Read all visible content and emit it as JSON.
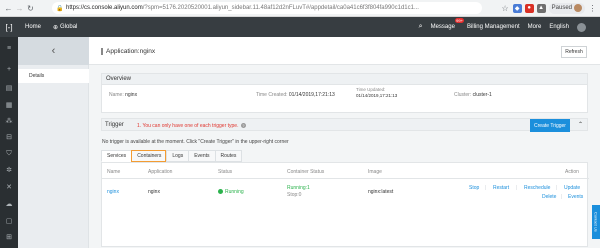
{
  "browser": {
    "url_host": "https://cs.console.aliyun.com",
    "url_path": "/?spm=5176.2020520001.aliyun_sidebar.11.48af12d2nFLuvT#/appdetail/ca0a41c6f3f804fa990c1d1c1...",
    "profile_status": "Paused"
  },
  "topbar": {
    "home": "Home",
    "region": "Global",
    "message": "Message",
    "message_badge": "99+",
    "billing": "Billing Management",
    "more": "More",
    "language": "English"
  },
  "sidebar": {
    "back_label": "‹",
    "items": [
      {
        "label": "Details"
      }
    ]
  },
  "page": {
    "title": "Application:nginx",
    "refresh_label": "Refresh"
  },
  "overview": {
    "heading": "Overview",
    "name_label": "Name:",
    "name_value": "nginx",
    "created_label": "Time Created:",
    "created_value": "01/14/2019,17:21:13",
    "updated_label": "Time Updated:",
    "updated_value": "01/14/2019,17:21:13",
    "cluster_label": "Cluster:",
    "cluster_value": "cluster-1"
  },
  "trigger": {
    "label": "Trigger",
    "warning": "1. You can only have one of each trigger type.",
    "create_label": "Create Trigger",
    "empty_message": "No trigger is available at the moment. Click \"Create Trigger\" in the upper-right corner"
  },
  "tabs": [
    {
      "label": "Services"
    },
    {
      "label": "Containers"
    },
    {
      "label": "Logs"
    },
    {
      "label": "Events"
    },
    {
      "label": "Routes"
    }
  ],
  "table": {
    "headers": {
      "name": "Name",
      "application": "Application",
      "status": "Status",
      "container_status": "Container Status",
      "image": "Image",
      "action": "Action"
    },
    "rows": [
      {
        "name": "nginx",
        "application": "nginx",
        "status": "Running",
        "container_running": "Running:1",
        "container_stopped": "Stop:0",
        "image": "nginx:latest",
        "actions": [
          "Stop",
          "Restart",
          "Reschedule",
          "Update",
          "Delete",
          "Events"
        ]
      }
    ]
  },
  "contact_label": "Contact Us",
  "colors": {
    "topbar": "#373d41",
    "primary": "#1b8fdc",
    "running": "#2bb24c",
    "warning": "#e0352e",
    "highlight": "#f39c33"
  }
}
